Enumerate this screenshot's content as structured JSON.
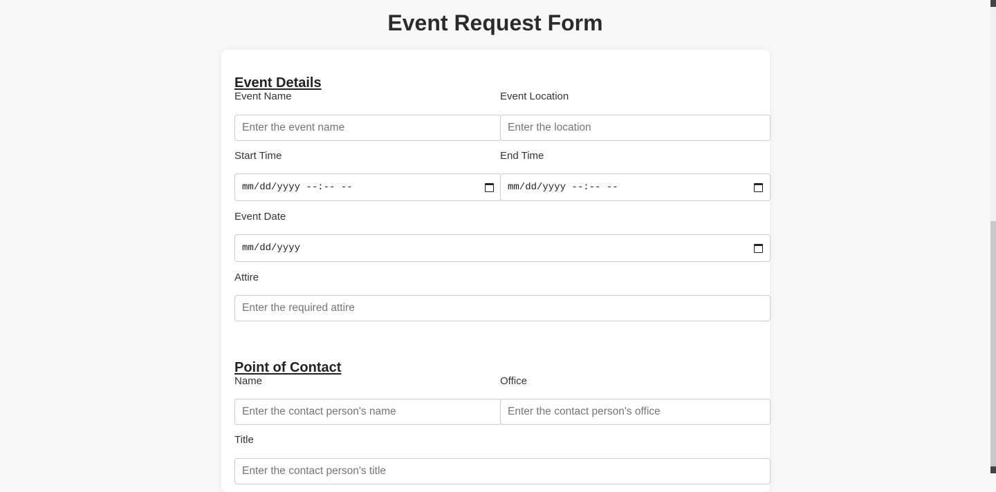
{
  "page": {
    "title": "Event Request Form"
  },
  "event_details": {
    "heading": "Event Details",
    "event_name": {
      "label": "Event Name",
      "placeholder": "Enter the event name"
    },
    "event_location": {
      "label": "Event Location",
      "placeholder": "Enter the location"
    },
    "start_time": {
      "label": "Start Time",
      "value": "mm/dd/yyyy --:-- --"
    },
    "end_time": {
      "label": "End Time",
      "value": "mm/dd/yyyy --:-- --"
    },
    "event_date": {
      "label": "Event Date",
      "value": "mm/dd/yyyy"
    },
    "attire": {
      "label": "Attire",
      "placeholder": "Enter the required attire"
    }
  },
  "point_of_contact": {
    "heading": "Point of Contact",
    "name": {
      "label": "Name",
      "placeholder": "Enter the contact person's name"
    },
    "office": {
      "label": "Office",
      "placeholder": "Enter the contact person's office"
    },
    "title": {
      "label": "Title",
      "placeholder": "Enter the contact person's title"
    }
  },
  "icons": {
    "date_picker": "calendar-icon"
  }
}
